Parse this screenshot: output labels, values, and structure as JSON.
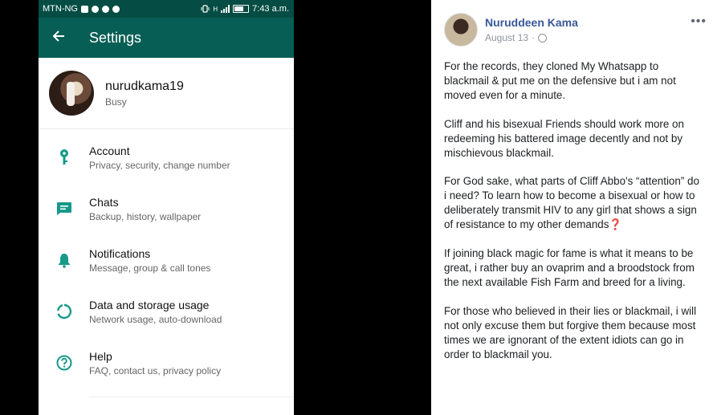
{
  "phone": {
    "status_bar": {
      "carrier": "MTN-NG",
      "time": "7:43 a.m.",
      "network": "H"
    },
    "app_bar": {
      "title": "Settings"
    },
    "profile": {
      "name": "nurudkama19",
      "status": "Busy"
    },
    "settings": [
      {
        "icon": "key-icon",
        "title": "Account",
        "subtitle": "Privacy, security, change number"
      },
      {
        "icon": "chat-icon",
        "title": "Chats",
        "subtitle": "Backup, history, wallpaper"
      },
      {
        "icon": "bell-icon",
        "title": "Notifications",
        "subtitle": "Message, group & call tones"
      },
      {
        "icon": "data-usage-icon",
        "title": "Data and storage usage",
        "subtitle": "Network usage, auto-download"
      },
      {
        "icon": "help-icon",
        "title": "Help",
        "subtitle": "FAQ, contact us, privacy policy"
      }
    ],
    "colors": {
      "accent": "#075e54",
      "statusbar": "#054d44",
      "icon": "#17998a"
    }
  },
  "post": {
    "author": "Nuruddeen Kama",
    "date": "August 13",
    "more_label": "•••",
    "paragraphs": [
      "For the records, they cloned My Whatsapp to blackmail & put me on the defensive but i am not moved even for a minute.",
      "Cliff and his bisexual Friends should work more on redeeming his battered image decently and not by mischievous blackmail.",
      "For God sake, what parts of Cliff Abbo's “attention” do i need? To learn how to become a bisexual or how to deliberately transmit HIV to any girl that shows a sign of resistance to my other demands❓",
      "If joining black magic for fame is what it means to be great, i rather buy an ovaprim and a broodstock from the next available Fish Farm and breed for a living.",
      "For those who believed in their lies or blackmail, i will not only excuse them but forgive them because most times we are ignorant of the extent idiots can go in order to blackmail you."
    ],
    "colors": {
      "author": "#385898",
      "meta": "#90949c"
    }
  }
}
